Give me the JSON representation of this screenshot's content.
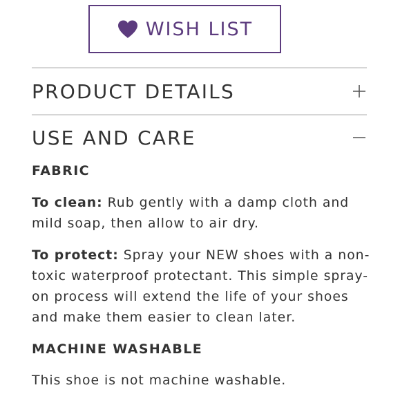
{
  "wishlist": {
    "label": "WISH LIST",
    "icon": "heart-icon",
    "color": "#5c3b7e"
  },
  "sections": [
    {
      "title": "PRODUCT DETAILS",
      "state": "collapsed",
      "icon": "plus-icon"
    },
    {
      "title": "USE AND CARE",
      "state": "expanded",
      "icon": "minus-icon"
    }
  ],
  "care": {
    "fabric_heading": "FABRIC",
    "clean_label": "To clean:",
    "clean_text": " Rub gently with a damp cloth and mild soap, then allow to air dry.",
    "protect_label": "To protect:",
    "protect_text": " Spray your NEW shoes with a non-toxic waterproof protectant. This simple spray-on process will extend the life of your shoes and make them easier to clean later.",
    "washable_heading": "MACHINE WASHABLE",
    "washable_text": "This shoe is not machine washable."
  }
}
